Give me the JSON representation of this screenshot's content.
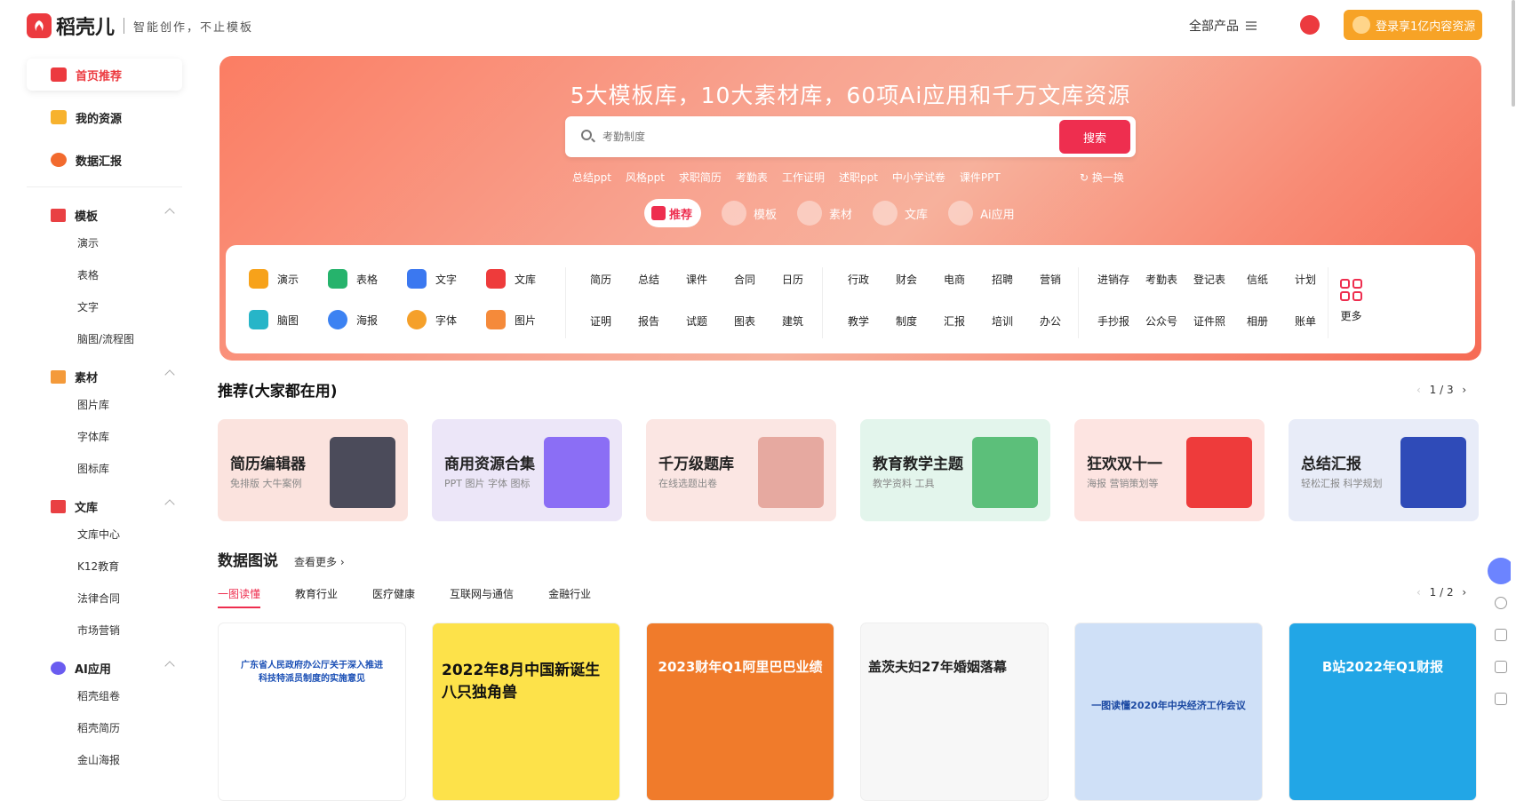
{
  "header": {
    "logo_name": "稻壳儿",
    "slogan": "智能创作，不止模板",
    "all_products": "全部产品",
    "login_button": "登录享1亿内容资源"
  },
  "sidebar": {
    "top_items": [
      {
        "label": "首页推荐",
        "active": true,
        "color": "#ec3a3f"
      },
      {
        "label": "我的资源",
        "active": false,
        "color": "#f7b22e"
      },
      {
        "label": "数据汇报",
        "active": false,
        "color": "#f26a2e"
      }
    ],
    "sections": [
      {
        "label": "模板",
        "color": "#e94043",
        "items": [
          "演示",
          "表格",
          "文字",
          "脑图/流程图"
        ]
      },
      {
        "label": "素材",
        "color": "#f49a3a",
        "items": [
          "图片库",
          "字体库",
          "图标库"
        ]
      },
      {
        "label": "文库",
        "color": "#e94043",
        "items": [
          "文库中心",
          "K12教育",
          "法律合同",
          "市场营销"
        ]
      },
      {
        "label": "AI应用",
        "color": "#6a5cf0",
        "items": [
          "稻壳组卷",
          "稻壳简历",
          "金山海报"
        ]
      }
    ]
  },
  "hero": {
    "title": "5大模板库，10大素材库，60项Ai应用和千万文库资源",
    "search_placeholder": "考勤制度",
    "search_button": "搜索",
    "hot_words": [
      "总结ppt",
      "风格ppt",
      "求职简历",
      "考勤表",
      "工作证明",
      "述职ppt",
      "中小学试卷",
      "课件PPT"
    ],
    "refresh": "换一换",
    "tabs": [
      "推荐",
      "模板",
      "素材",
      "文库",
      "Ai应用"
    ],
    "active_tab": "推荐"
  },
  "panel": {
    "tools": [
      {
        "label": "演示",
        "color": "#f7a21a"
      },
      {
        "label": "表格",
        "color": "#26b36c"
      },
      {
        "label": "文字",
        "color": "#3b78f0"
      },
      {
        "label": "文库",
        "color": "#ee3b3b"
      },
      {
        "label": "脑图",
        "color": "#27b5c8"
      },
      {
        "label": "海报",
        "color": "#3c82f2"
      },
      {
        "label": "字体",
        "color": "#f5a02a"
      },
      {
        "label": "图片",
        "color": "#f58a3a"
      }
    ],
    "group1": [
      "简历",
      "总结",
      "课件",
      "合同",
      "日历",
      "证明",
      "报告",
      "试题",
      "图表",
      "建筑"
    ],
    "group2": [
      "行政",
      "财会",
      "电商",
      "招聘",
      "营销",
      "教学",
      "制度",
      "汇报",
      "培训",
      "办公"
    ],
    "group3": [
      "进销存",
      "考勤表",
      "登记表",
      "信纸",
      "计划",
      "手抄报",
      "公众号",
      "证件照",
      "相册",
      "账单"
    ],
    "more": "更多"
  },
  "recommend": {
    "title": "推荐(大家都在用)",
    "pager": "1 / 3",
    "cards": [
      {
        "title": "简历编辑器",
        "subtitle": "免排版 大牛案例",
        "bg": "#fbe3de",
        "deco": "#4b4b5a"
      },
      {
        "title": "商用资源合集",
        "subtitle": "PPT 图片 字体 图标",
        "bg": "#ece6f8",
        "deco": "#8b6ef5"
      },
      {
        "title": "千万级题库",
        "subtitle": "在线选题出卷",
        "bg": "#fbe6e3",
        "deco": "#e6a9a0"
      },
      {
        "title": "教育教学主题",
        "subtitle": "教学资料 工具",
        "bg": "#e3f5ec",
        "deco": "#5cbf7a"
      },
      {
        "title": "狂欢双十一",
        "subtitle": "海报 营销策划等",
        "bg": "#fde4e1",
        "deco": "#ee3b3b"
      },
      {
        "title": "总结汇报",
        "subtitle": "轻松汇报 科学规划",
        "bg": "#e8ecf8",
        "deco": "#2f4bb8"
      }
    ]
  },
  "data_section": {
    "title": "数据图说",
    "see_more": "查看更多",
    "tabs": [
      "一图读懂",
      "教育行业",
      "医疗健康",
      "互联网与通信",
      "金融行业"
    ],
    "active_tab": "一图读懂",
    "pager": "1 / 2",
    "cards": [
      {
        "title": "广东省人民政府办公厅关于深入推进科技特派员制度的实施意见",
        "bg": "#ffffff",
        "color": "#1a4fb5"
      },
      {
        "title": "2022年8月中国新诞生八只独角兽",
        "bg": "#fde24a",
        "color": "#111111"
      },
      {
        "title": "2023财年Q1阿里巴巴业绩",
        "bg": "#f07b2b",
        "color": "#ffffff"
      },
      {
        "title": "盖茨夫妇27年婚姻落幕",
        "bg": "#f7f7f7",
        "color": "#222222"
      },
      {
        "title": "一图读懂2020年中央经济工作会议",
        "bg": "#cfe0f7",
        "color": "#1d4aa3"
      },
      {
        "title": "B站2022年Q1财报",
        "bg": "#22a6e6",
        "color": "#ffffff"
      }
    ]
  }
}
